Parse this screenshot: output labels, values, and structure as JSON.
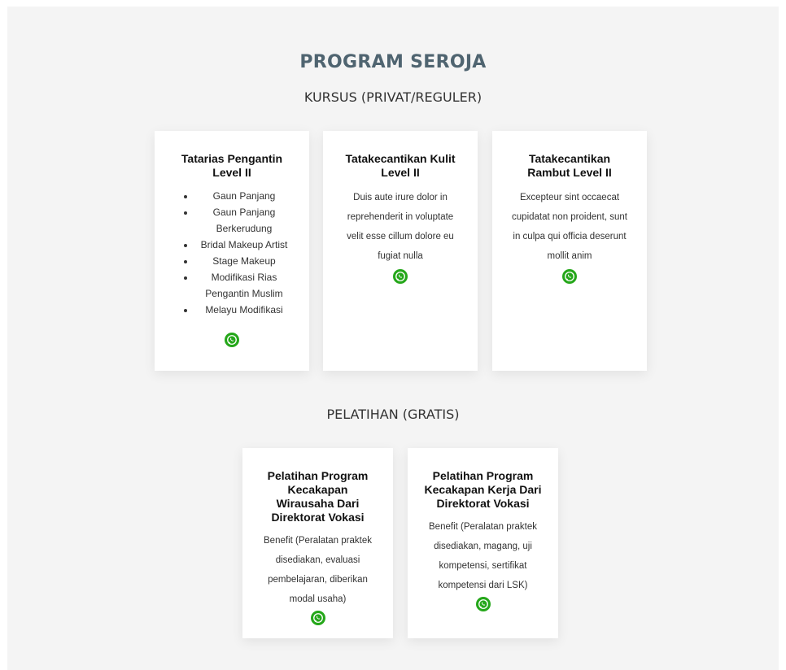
{
  "page": {
    "title": "PROGRAM SEROJA",
    "kursus_heading": "KURSUS (PRIVAT/REGULER)",
    "pelatihan_heading": "PELATIHAN (GRATIS)"
  },
  "kursus": [
    {
      "title": "Tatarias Pengantin Level II",
      "items": [
        "Gaun Panjang",
        "Gaun Panjang Berkerudung",
        "Bridal Makeup Artist",
        "Stage Makeup",
        "Modifikasi Rias Pengantin Muslim",
        "Melayu Modifikasi"
      ],
      "icon": "whatsapp-icon"
    },
    {
      "title": "Tatakecantikan Kulit Level II",
      "text": "Duis aute irure dolor in reprehenderit in voluptate velit esse cillum dolore eu fugiat nulla",
      "icon": "whatsapp-icon"
    },
    {
      "title": "Tatakecantikan Rambut Level II",
      "text": "Excepteur sint occaecat cupidatat non proident, sunt in culpa qui officia deserunt mollit anim",
      "icon": "whatsapp-icon"
    }
  ],
  "pelatihan": [
    {
      "title": "Pelatihan Program Kecakapan Wirausaha Dari Direktorat Vokasi",
      "text": "Benefit (Peralatan praktek disediakan, evaluasi pembelajaran, diberikan modal usaha)",
      "icon": "whatsapp-icon"
    },
    {
      "title": "Pelatihan Program Kecakapan Kerja Dari Direktorat Vokasi",
      "text": "Benefit (Peralatan praktek disediakan, magang, uji kompetensi, sertifikat kompetensi dari LSK)",
      "icon": "whatsapp-icon"
    }
  ],
  "colors": {
    "title": "#4f6470",
    "whatsapp": "#25a71a",
    "section_bg": "#f4f4f4"
  }
}
